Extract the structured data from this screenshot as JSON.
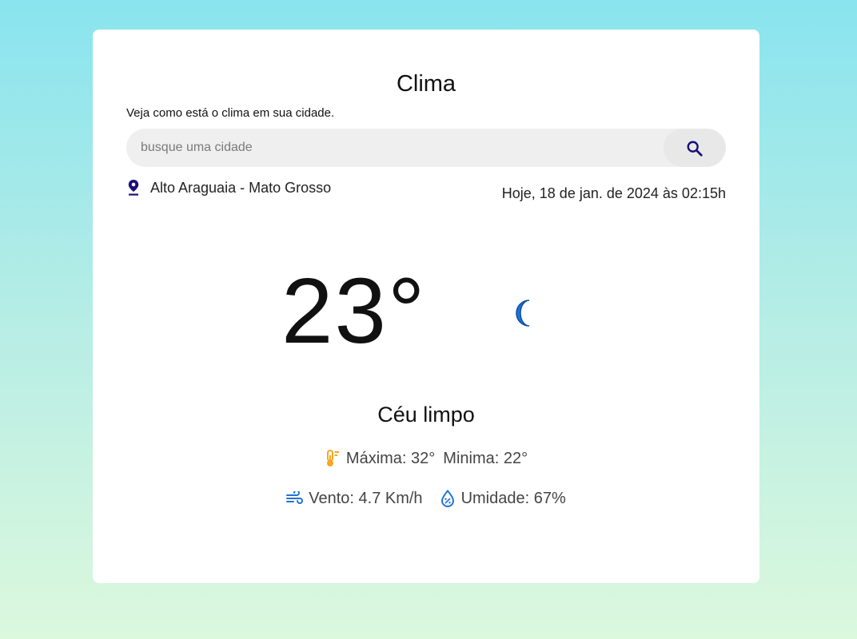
{
  "app": {
    "title": "Clima",
    "subtitle": "Veja como está o clima em sua cidade."
  },
  "search": {
    "placeholder": "busque uma cidade",
    "value": "",
    "button_icon": "search-icon"
  },
  "location": {
    "icon": "location-pin-icon",
    "name": "Alto Araguaia - Mato Grosso"
  },
  "datetime": "Hoje, 18 de jan. de 2024 às 02:15h",
  "weather": {
    "temperature": "23°",
    "condition_icon": "moon-icon",
    "condition": "Céu limpo",
    "max_label": "Máxima: 32°",
    "min_label": "Minima: 22°",
    "wind_label": "Vento: 4.7 Km/h",
    "humidity_label": "Umidade: 67%"
  },
  "colors": {
    "accent": "#1a0f7a",
    "icon_blue": "#1e74d6",
    "thermometer_orange": "#f5a623"
  }
}
